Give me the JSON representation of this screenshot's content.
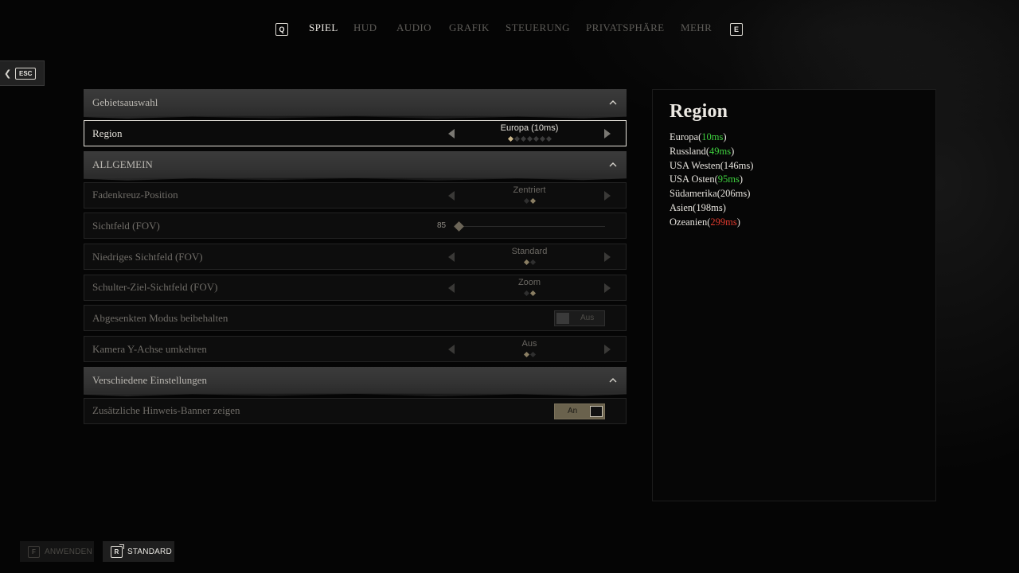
{
  "topnav": {
    "prev_key": "Q",
    "next_key": "E",
    "tabs": [
      {
        "label": "SPIEL",
        "active": true
      },
      {
        "label": "HUD",
        "active": false
      },
      {
        "label": "AUDIO",
        "active": false
      },
      {
        "label": "GRAFIK",
        "active": false
      },
      {
        "label": "STEUERUNG",
        "active": false
      },
      {
        "label": "PRIVATSPHÄRE",
        "active": false
      },
      {
        "label": "MEHR",
        "active": false
      }
    ]
  },
  "back": {
    "key": "ESC",
    "icon": "chevron-left-icon"
  },
  "sections": {
    "region_select": {
      "title": "Gebietsauswahl",
      "region": {
        "label": "Region",
        "value": "Europa (10ms)",
        "option_count": 7,
        "selected_index": 0
      }
    },
    "general": {
      "title": "ALLGEMEIN",
      "crosshair": {
        "label": "Fadenkreuz-Position",
        "value": "Zentriert",
        "option_count": 2,
        "selected_index": 1
      },
      "fov": {
        "label": "Sichtfeld (FOV)",
        "value": "85",
        "slider_fraction": 0.0
      },
      "low_fov": {
        "label": "Niedriges Sichtfeld (FOV)",
        "value": "Standard",
        "option_count": 2,
        "selected_index": 0
      },
      "shoulder_fov": {
        "label": "Schulter-Ziel-Sichtfeld (FOV)",
        "value": "Zoom",
        "option_count": 2,
        "selected_index": 1
      },
      "lowered_mode": {
        "label": "Abgesenkten Modus beibehalten",
        "toggle_label": "Aus",
        "on": false
      },
      "invert_y": {
        "label": "Kamera Y-Achse umkehren",
        "value": "Aus",
        "option_count": 2,
        "selected_index": 0
      }
    },
    "misc": {
      "title": "Verschiedene Einstellungen",
      "hint_banners": {
        "label": "Zusätzliche Hinweis-Banner zeigen",
        "toggle_label": "An",
        "on": true
      }
    }
  },
  "info_panel": {
    "title": "Region",
    "regions": [
      {
        "name": "Europa",
        "open": "(",
        "ping": "10ms",
        "close": ")",
        "quality": "good"
      },
      {
        "name": "Russland",
        "open": "(",
        "ping": "49ms",
        "close": ")",
        "quality": "good"
      },
      {
        "name": "USA Westen",
        "open": "(",
        "ping": "146ms",
        "close": ")",
        "quality": "normal"
      },
      {
        "name": "USA Osten",
        "open": "(",
        "ping": "95ms",
        "close": ")",
        "quality": "good"
      },
      {
        "name": "Südamerika",
        "open": "(",
        "ping": "206ms",
        "close": ")",
        "quality": "normal"
      },
      {
        "name": "Asien",
        "open": "(",
        "ping": "198ms",
        "close": ")",
        "quality": "normal"
      },
      {
        "name": "Ozeanien",
        "open": "(",
        "ping": "299ms",
        "close": ")",
        "quality": "bad"
      }
    ],
    "colors": {
      "good": "#3fd13f",
      "bad": "#e23b2e"
    }
  },
  "bottom": {
    "apply": {
      "key": "F",
      "label": "ANWENDEN",
      "enabled": false
    },
    "default": {
      "key": "R",
      "label": "STANDARD",
      "enabled": true
    }
  }
}
